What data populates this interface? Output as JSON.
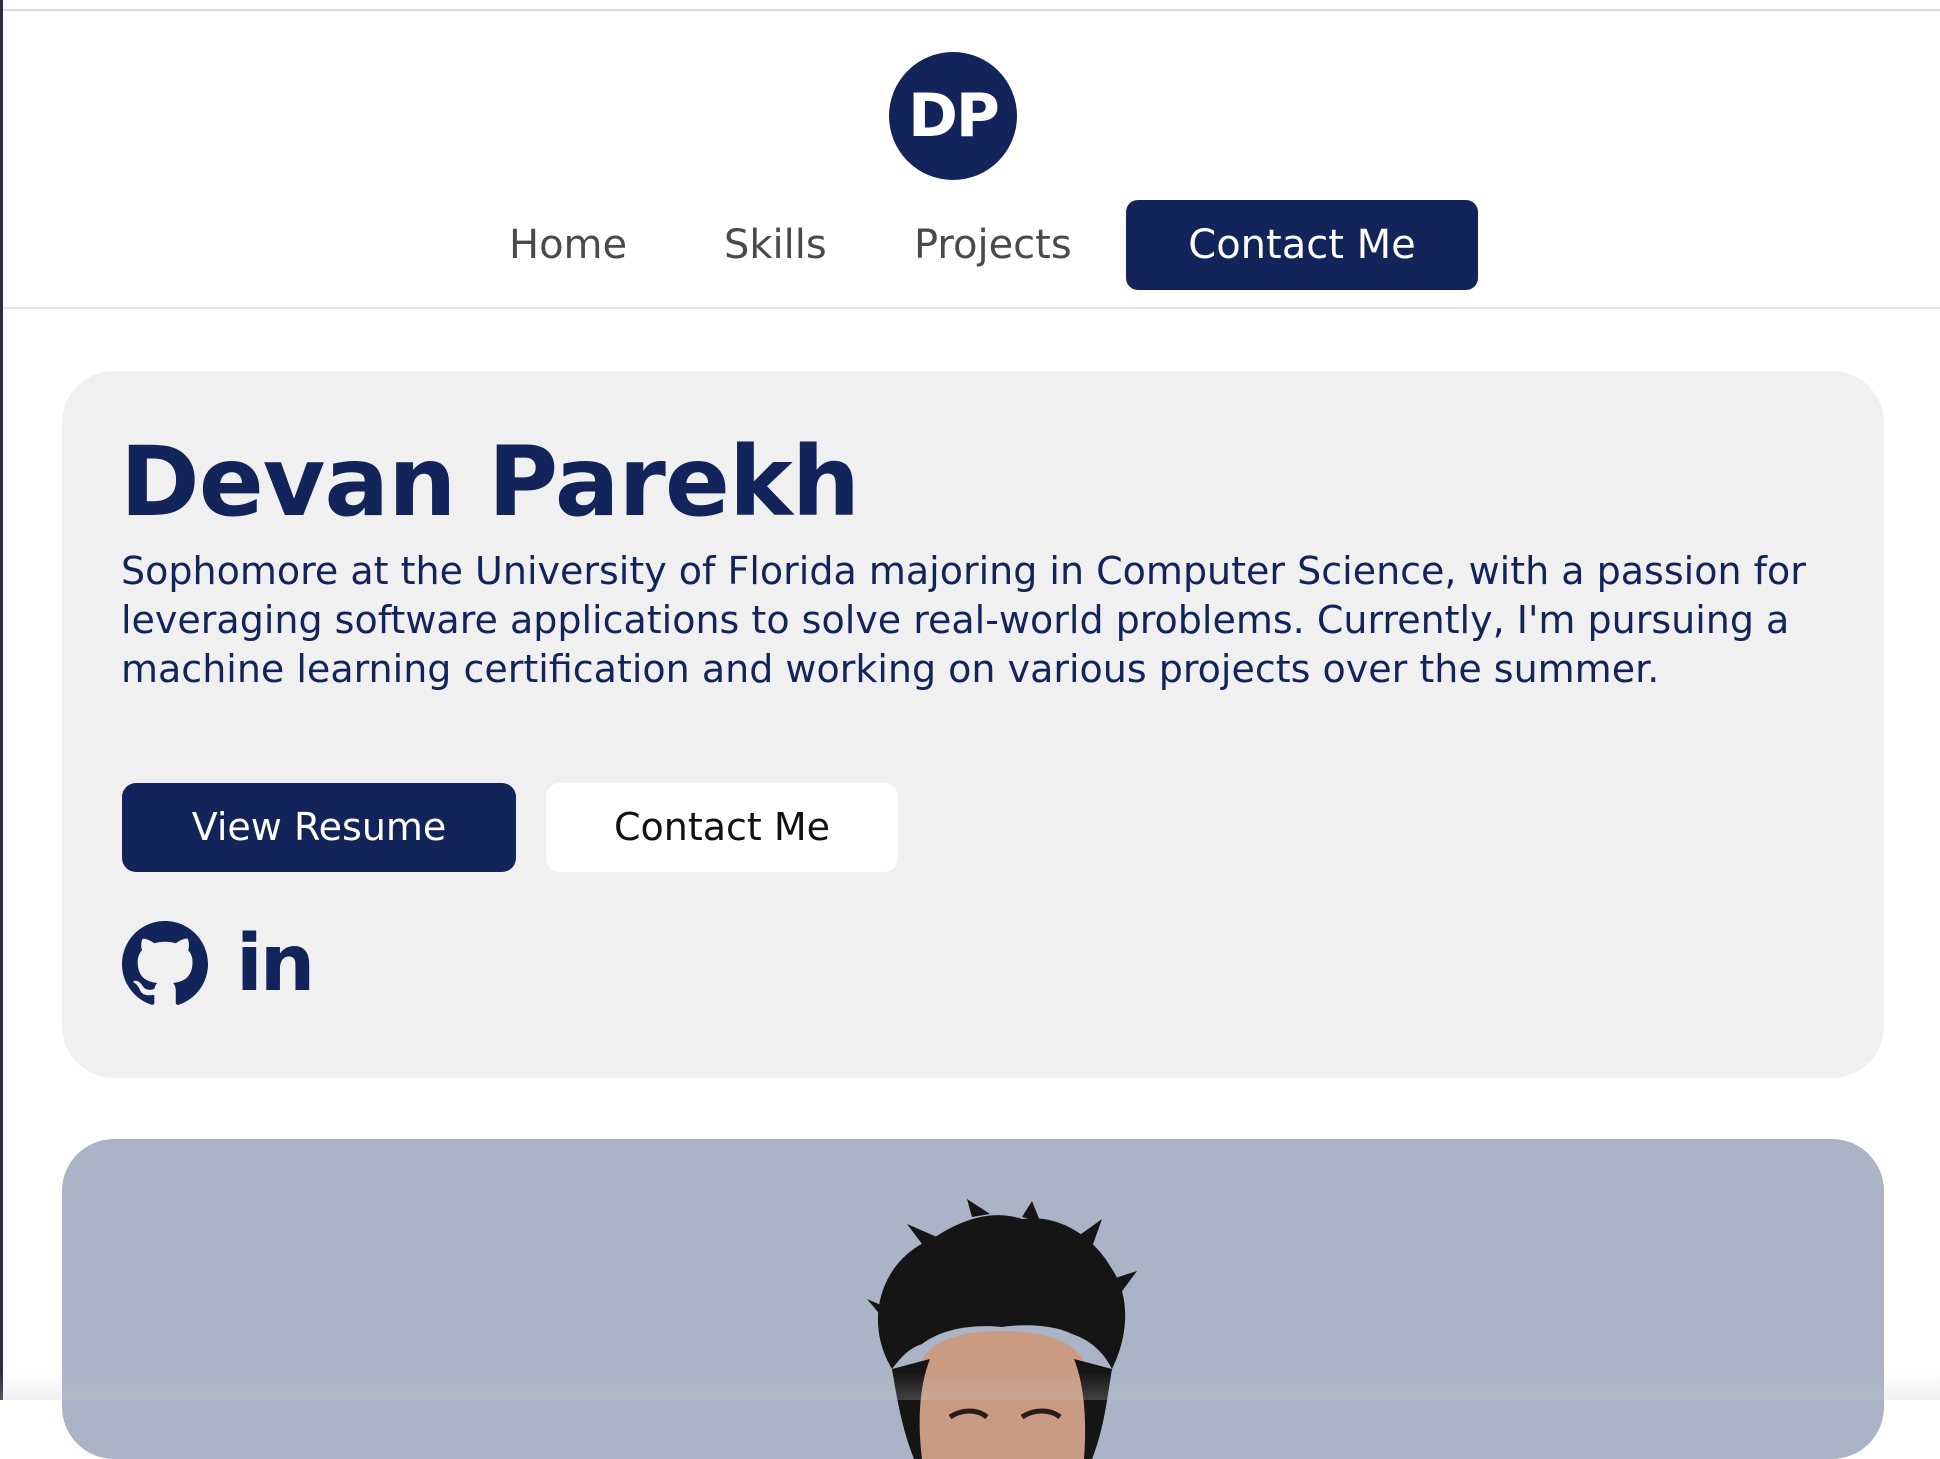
{
  "header": {
    "logo_initials": "DP",
    "nav": {
      "home": "Home",
      "skills": "Skills",
      "projects": "Projects",
      "contact": "Contact Me"
    }
  },
  "hero": {
    "name": "Devan Parekh",
    "bio": "Sophomore at the University of Florida majoring in Computer Science, with a passion for leveraging software applications to solve real-world problems. Currently, I'm pursuing a machine learning certification and working on various projects over the summer.",
    "resume_button": "View Resume",
    "contact_button": "Contact Me",
    "social": {
      "github_icon": "github-icon",
      "linkedin_icon": "linkedin-icon",
      "linkedin_text": "in"
    }
  },
  "colors": {
    "brand": "#12245a",
    "card_bg": "#f0f0f0",
    "photo_bg": "#aab4c6"
  }
}
